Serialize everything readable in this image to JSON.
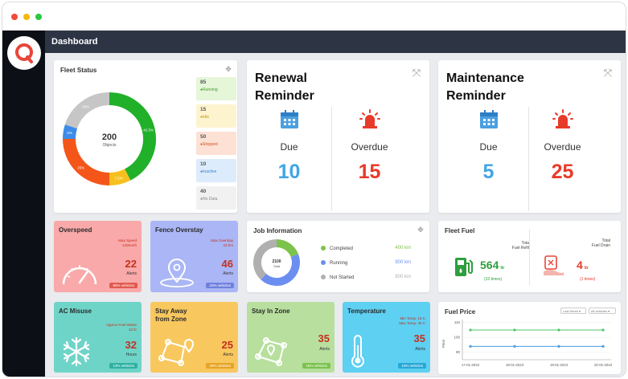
{
  "page": {
    "title": "Dashboard"
  },
  "colors": {
    "sidebar": "#0c1016",
    "topbar": "#2d3545",
    "accent_red": "#e83a2a",
    "accent_blue": "#42a5e4",
    "green": "#2e9e3e"
  },
  "fleet_status": {
    "title": "Fleet Status",
    "total": "200",
    "total_label": "Objects",
    "segments": [
      {
        "label": "Running",
        "value": 85,
        "pct": "42.5%",
        "color": "#21b02a"
      },
      {
        "label": "Idle",
        "value": 15,
        "pct": "7.5%",
        "color": "#f6c01e"
      },
      {
        "label": "Stopped",
        "value": 50,
        "pct": "25%",
        "color": "#f4561a"
      },
      {
        "label": "Inactive",
        "value": 10,
        "pct": "5%",
        "color": "#3d8ce8"
      },
      {
        "label": "No Data",
        "value": 40,
        "pct": "20%",
        "color": "#c6c6c6"
      }
    ],
    "items": [
      {
        "count": "85",
        "label": "Running",
        "bg": "#e6f6d9",
        "color": "#3f9b2c"
      },
      {
        "count": "15",
        "label": "Idle",
        "bg": "#fdf4cf",
        "color": "#c39a0a"
      },
      {
        "count": "50",
        "label": "Stopped",
        "bg": "#fde1d5",
        "color": "#d4521e"
      },
      {
        "count": "10",
        "label": "Inactive",
        "bg": "#dcecfc",
        "color": "#3c7fd2"
      },
      {
        "count": "40",
        "label": "No Data",
        "bg": "#f1f1f1",
        "color": "#888888"
      }
    ]
  },
  "renewal": {
    "title_line1": "Renewal",
    "title_line2": "Reminder",
    "due_label": "Due",
    "due_value": "10",
    "overdue_label": "Overdue",
    "overdue_value": "15"
  },
  "maintenance": {
    "title_line1": "Maintenance",
    "title_line2": "Reminder",
    "due_label": "Due",
    "due_value": "5",
    "overdue_label": "Overdue",
    "overdue_value": "25"
  },
  "overspeed": {
    "title": "Overspeed",
    "info1": "Max Speed",
    "info2": "120Km/h",
    "value": "22",
    "sub": "Alerts",
    "badge": "80% vehicles"
  },
  "fence_overstay": {
    "title": "Fence Overstay",
    "info1": "Max Overstay",
    "info2": "23 hrs",
    "value": "46",
    "sub": "Alerts",
    "badge": "10% vehicles"
  },
  "job_info": {
    "title": "Job Information",
    "total": "2100",
    "total_label": "Total",
    "rows": [
      {
        "label": "Completed",
        "value": "400 km",
        "color": "#7dc24b"
      },
      {
        "label": "Running",
        "value": "900 km",
        "color": "#6b8ef0"
      },
      {
        "label": "Not Started",
        "value": "800 km",
        "color": "#b0b0b0"
      }
    ]
  },
  "fleet_fuel": {
    "title": "Fleet Fuel",
    "refill_label1": "Total",
    "refill_label2": "Fuel Refill",
    "refill_value": "564",
    "refill_unit": "ltr",
    "refill_times": "(32 times)",
    "drain_label1": "Total",
    "drain_label2": "Fuel Drain",
    "drain_value": "4",
    "drain_unit": "ltr",
    "drain_times": "(1 times)"
  },
  "ac_misuse": {
    "title": "AC Misuse",
    "info1": "Approx Fuel Waste",
    "info2": "22 ltr",
    "value": "32",
    "sub": "Hours",
    "badge": "13% vehicles"
  },
  "stay_away": {
    "title_line1": "Stay Away",
    "title_line2": "from Zone",
    "value": "25",
    "sub": "Alerts",
    "badge": "20% vehicles"
  },
  "stay_in": {
    "title": "Stay In Zone",
    "value": "35",
    "sub": "Alerts",
    "badge": "15% vehicles"
  },
  "temperature": {
    "title": "Temperature",
    "info1": "Min Temp. 15 C",
    "info2": "Max Temp. 40 C",
    "value": "35",
    "sub": "Alerts",
    "badge": "10% vehicles"
  },
  "fuel_price": {
    "title": "Fuel Price",
    "dropdown1": "Last Week",
    "dropdown2": "All vehicles",
    "ylabel": "Price",
    "yticks": [
      "110",
      "100",
      "90"
    ],
    "xticks": [
      "17-01-2023",
      "18-01-2023",
      "19-01-2023",
      "20-01-2023"
    ]
  },
  "chart_data": [
    {
      "type": "pie",
      "title": "Fleet Status",
      "categories": [
        "Running",
        "Idle",
        "Stopped",
        "Inactive",
        "No Data"
      ],
      "values": [
        85,
        15,
        50,
        10,
        40
      ]
    },
    {
      "type": "pie",
      "title": "Job Information",
      "categories": [
        "Completed",
        "Running",
        "Not Started"
      ],
      "values": [
        400,
        900,
        800
      ]
    },
    {
      "type": "line",
      "title": "Fuel Price",
      "x": [
        "17-01-2023",
        "18-01-2023",
        "19-01-2023",
        "20-01-2023"
      ],
      "series": [
        {
          "values": [
            105,
            105,
            105,
            105
          ],
          "color": "#4fc46a"
        },
        {
          "values": [
            94,
            94,
            94,
            94
          ],
          "color": "#4a9be3"
        }
      ],
      "ylabel": "Price",
      "ylim": [
        85,
        112
      ]
    }
  ]
}
